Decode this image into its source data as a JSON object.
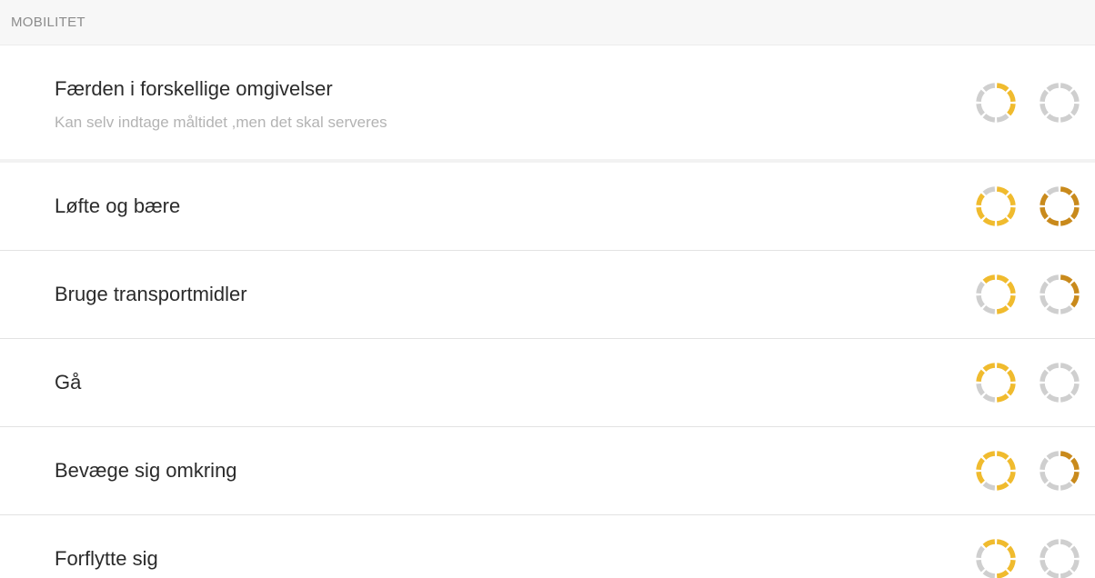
{
  "section": {
    "title": "MOBILITET"
  },
  "colors": {
    "grey": "#cfcfcf",
    "yellow": "#f0bb2e",
    "brown": "#c98a1c"
  },
  "rows": [
    {
      "title": "Færden i forskellige omgivelser",
      "subtitle": "Kan selv indtage måltidet ,men det skal serveres",
      "rings": [
        [
          "yellow",
          "yellow",
          "yellow",
          "grey",
          "grey",
          "grey",
          "grey",
          "grey"
        ],
        [
          "grey",
          "grey",
          "grey",
          "grey",
          "grey",
          "grey",
          "grey",
          "grey"
        ]
      ]
    },
    {
      "title": "Løfte og bære",
      "rings": [
        [
          "yellow",
          "yellow",
          "yellow",
          "yellow",
          "yellow",
          "yellow",
          "yellow",
          "grey"
        ],
        [
          "brown",
          "brown",
          "brown",
          "brown",
          "brown",
          "brown",
          "brown",
          "grey"
        ]
      ]
    },
    {
      "title": "Bruge transportmidler",
      "rings": [
        [
          "yellow",
          "yellow",
          "yellow",
          "yellow",
          "grey",
          "grey",
          "grey",
          "yellow"
        ],
        [
          "brown",
          "brown",
          "brown",
          "grey",
          "grey",
          "grey",
          "grey",
          "grey"
        ]
      ]
    },
    {
      "title": "Gå",
      "rings": [
        [
          "yellow",
          "yellow",
          "yellow",
          "yellow",
          "grey",
          "grey",
          "yellow",
          "yellow"
        ],
        [
          "grey",
          "grey",
          "grey",
          "grey",
          "grey",
          "grey",
          "grey",
          "grey"
        ]
      ]
    },
    {
      "title": "Bevæge sig omkring",
      "rings": [
        [
          "yellow",
          "yellow",
          "yellow",
          "yellow",
          "grey",
          "yellow",
          "yellow",
          "yellow"
        ],
        [
          "brown",
          "brown",
          "brown",
          "grey",
          "grey",
          "grey",
          "grey",
          "grey"
        ]
      ]
    },
    {
      "title": "Forflytte sig",
      "rings": [
        [
          "yellow",
          "yellow",
          "yellow",
          "yellow",
          "grey",
          "grey",
          "grey",
          "yellow"
        ],
        [
          "grey",
          "grey",
          "grey",
          "grey",
          "grey",
          "grey",
          "grey",
          "grey"
        ]
      ]
    }
  ]
}
